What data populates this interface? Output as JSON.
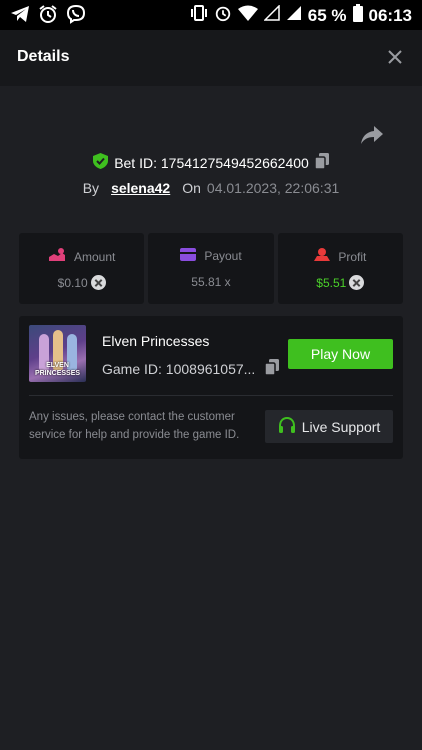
{
  "status_bar": {
    "battery": "65 %",
    "time": "06:13"
  },
  "header": {
    "title": "Details"
  },
  "bet": {
    "id_text": "Bet ID: 1754127549452662400",
    "by_label": "By",
    "user": "selena42",
    "on_label": "On",
    "date": "04.01.2023, 22:06:31"
  },
  "stats": {
    "amount": {
      "label": "Amount",
      "value": "$0.10"
    },
    "payout": {
      "label": "Payout",
      "value": "55.81 x"
    },
    "profit": {
      "label": "Profit",
      "value": "$5.51"
    }
  },
  "game": {
    "name": "Elven Princesses",
    "id_text": "Game ID: 1008961057...",
    "thumb_text_line1": "ELVEN",
    "thumb_text_line2": "PRINCESSES",
    "play_label": "Play Now"
  },
  "support": {
    "text": "Any issues, please contact the customer service for help and provide the game ID.",
    "button_label": "Live Support"
  },
  "colors": {
    "accent_green": "#3fbf1f",
    "profit_green": "#4bd02a",
    "amount_icon": "#e0407a",
    "payout_icon": "#8a4dde",
    "profit_icon": "#e83a3a"
  }
}
